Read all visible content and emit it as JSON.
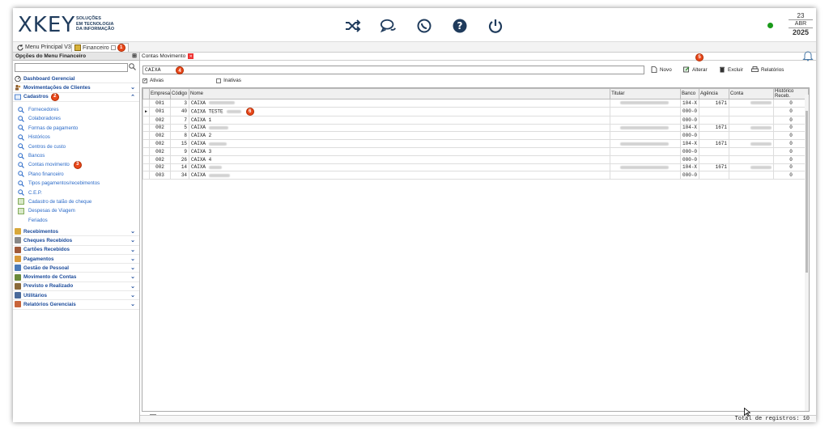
{
  "header": {
    "logo": "XKEY",
    "logo_sub_1": "SOLUÇÕES",
    "logo_sub_2": "EM TECNOLOGIA",
    "logo_sub_3": "DA INFORMAÇÃO",
    "date_day": "23",
    "date_month": "ABR",
    "date_year": "2025",
    "icons": [
      "shuffle-icon",
      "chat-icon",
      "whatsapp-icon",
      "help-icon",
      "power-icon"
    ]
  },
  "tabs": [
    {
      "label": "Menu Principal V3"
    },
    {
      "label": "Financeiro",
      "badge": "1"
    }
  ],
  "sidebar": {
    "title": "Opções do Menu Financeiro",
    "search_placeholder": "",
    "top_items": [
      {
        "label": "Dashboard Gerencial"
      },
      {
        "label": "Movimentações de Clientes"
      },
      {
        "label": "Cadastros",
        "badge": "2"
      }
    ],
    "sub_items": [
      {
        "label": "Fornecedores"
      },
      {
        "label": "Colaboradores"
      },
      {
        "label": "Formas de pagamento"
      },
      {
        "label": "Históricos"
      },
      {
        "label": "Centros de custo"
      },
      {
        "label": "Bancos"
      },
      {
        "label": "Contas movimento",
        "badge": "3"
      },
      {
        "label": "Plano financeiro"
      },
      {
        "label": "Tipos pagamentos/recebimentos"
      },
      {
        "label": "C.E.P."
      },
      {
        "label": "Cadastro de talão de cheque"
      },
      {
        "label": "Despesas de Viagem"
      },
      {
        "label": "Feriados"
      }
    ],
    "bottom_items": [
      {
        "label": "Recebimentos"
      },
      {
        "label": "Cheques Recebidos"
      },
      {
        "label": "Cartões Recebidos"
      },
      {
        "label": "Pagamentos"
      },
      {
        "label": "Gestão de Pessoal"
      },
      {
        "label": "Movimento de Contas"
      },
      {
        "label": "Previsto e Realizado"
      },
      {
        "label": "Utilitários"
      },
      {
        "label": "Relatórios Gerenciais"
      }
    ]
  },
  "main": {
    "tab_label": "Contas Movimento",
    "tab_badge": "5",
    "search_value": "CAIXA",
    "search_badge": "4",
    "buttons": {
      "novo": "Novo",
      "alterar": "Alterar",
      "excluir": "Excluir",
      "relatorios": "Relatórios"
    },
    "filter_ativas": "Ativas",
    "filter_inativas": "Inativas",
    "columns": [
      "Empresa",
      "Código",
      "Nome",
      "Titular",
      "Banco",
      "Agência",
      "Conta",
      "Histórico Receb."
    ],
    "rows": [
      {
        "empresa": "001",
        "codigo": "3",
        "nome": "CAIXA",
        "banco": "104-X",
        "agencia": "1671",
        "hist": "0"
      },
      {
        "empresa": "001",
        "codigo": "40",
        "nome": "CAIXA TESTE",
        "banco": "000-0",
        "agencia": "",
        "hist": "0",
        "badge": "6"
      },
      {
        "empresa": "002",
        "codigo": "7",
        "nome": "CAIXA 1",
        "banco": "000-0",
        "agencia": "",
        "hist": "0"
      },
      {
        "empresa": "002",
        "codigo": "5",
        "nome": "CAIXA",
        "banco": "104-X",
        "agencia": "1671",
        "hist": "0"
      },
      {
        "empresa": "002",
        "codigo": "8",
        "nome": "CAIXA 2",
        "banco": "000-0",
        "agencia": "",
        "hist": "0"
      },
      {
        "empresa": "002",
        "codigo": "15",
        "nome": "CAIXA",
        "banco": "104-X",
        "agencia": "1671",
        "hist": "0"
      },
      {
        "empresa": "002",
        "codigo": "9",
        "nome": "CAIXA 3",
        "banco": "000-0",
        "agencia": "",
        "hist": "0"
      },
      {
        "empresa": "002",
        "codigo": "26",
        "nome": "CAIXA 4",
        "banco": "000-0",
        "agencia": "",
        "hist": "0"
      },
      {
        "empresa": "002",
        "codigo": "14",
        "nome": "CAIXA",
        "banco": "104-X",
        "agencia": "1671",
        "hist": "0"
      },
      {
        "empresa": "003",
        "codigo": "34",
        "nome": "CAIXA",
        "banco": "000-0",
        "agencia": "",
        "hist": "0"
      }
    ],
    "status": "Total de registros: 10"
  }
}
